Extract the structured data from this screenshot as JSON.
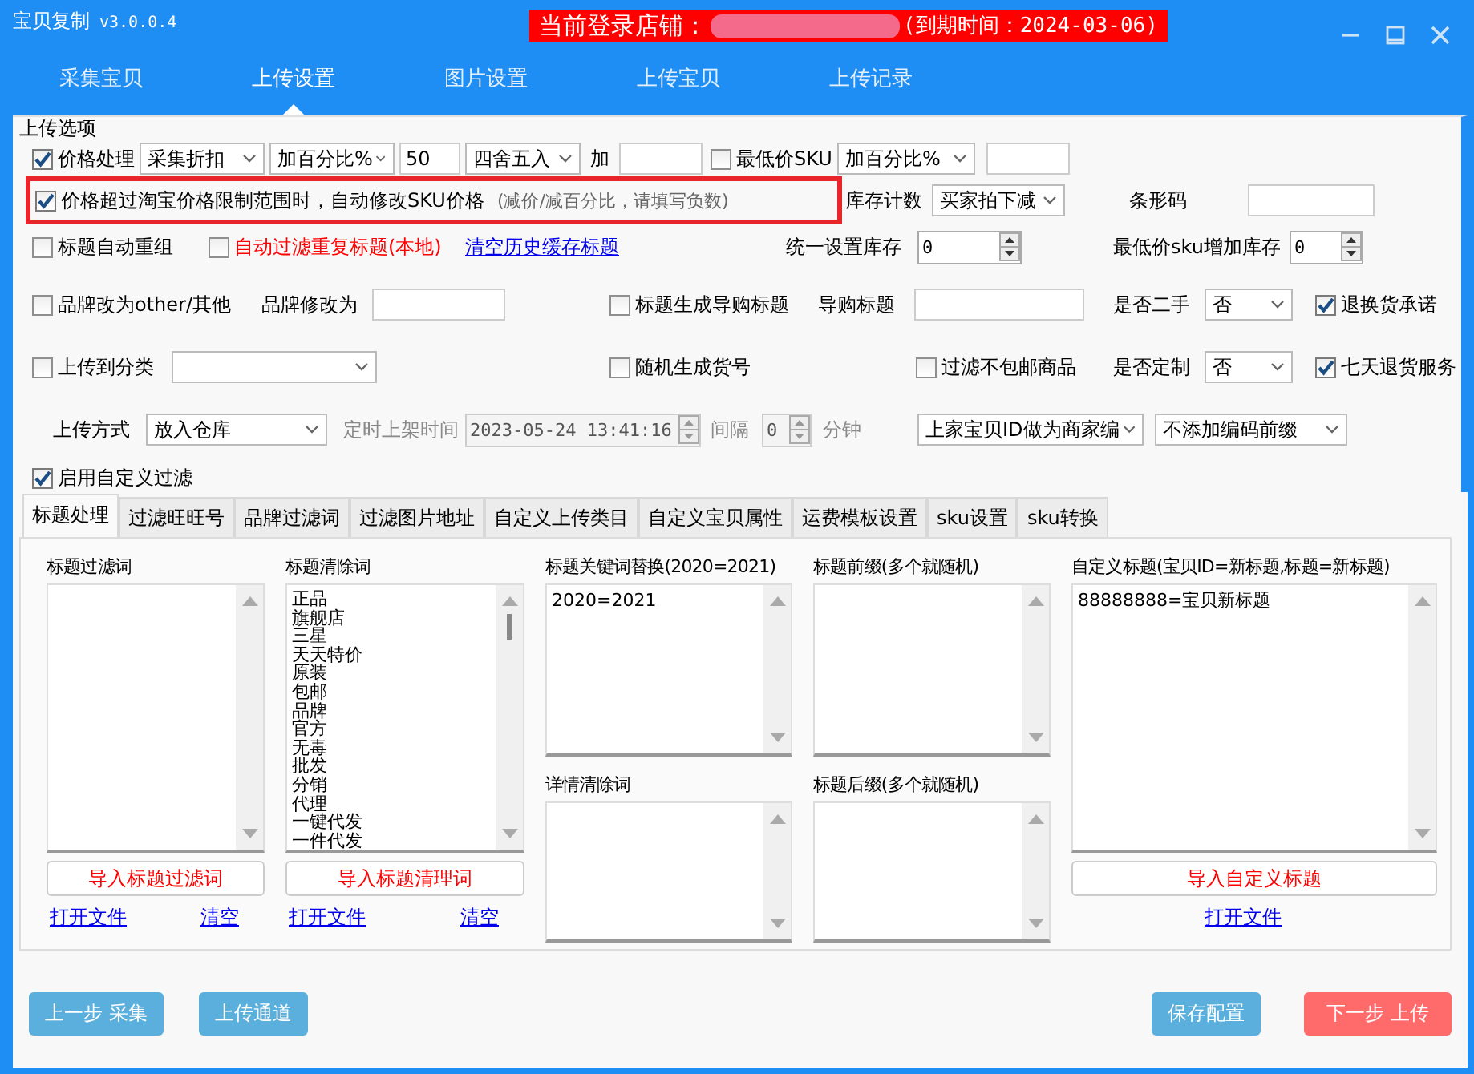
{
  "window": {
    "title": "宝贝复制",
    "version": "v3.0.0.4"
  },
  "login_banner": {
    "label": "当前登录店铺：",
    "expiry": "(到期时间：2024-03-06)"
  },
  "nav_tabs": [
    {
      "label": "采集宝贝",
      "selected": false
    },
    {
      "label": "上传设置",
      "selected": true
    },
    {
      "label": "图片设置",
      "selected": false
    },
    {
      "label": "上传宝贝",
      "selected": false
    },
    {
      "label": "上传记录",
      "selected": false
    }
  ],
  "options": {
    "title": "上传选项",
    "rows": [
      {
        "items": [
          {
            "kind": "checkbox",
            "label": "价格处理",
            "checked": true
          },
          {
            "kind": "select",
            "value": "采集折扣"
          },
          {
            "kind": "select",
            "value": "加百分比%"
          },
          {
            "kind": "input",
            "value": "50"
          },
          {
            "kind": "select",
            "value": "四舍五入"
          },
          {
            "kind": "label",
            "text": "加"
          },
          {
            "kind": "input"
          },
          {
            "kind": "checkbox",
            "label": "最低价SKU",
            "checked": false
          },
          {
            "kind": "select",
            "value": "加百分比%"
          },
          {
            "kind": "input"
          }
        ]
      },
      {
        "items": [
          {
            "kind": "group",
            "highlighted": true,
            "items": [
              {
                "kind": "checkbox",
                "label": "价格超过淘宝价格限制范围时，自动修改SKU价格",
                "checked": true
              },
              {
                "kind": "hint",
                "text": "(减价/减百分比，请填写负数)"
              }
            ]
          },
          {
            "kind": "label",
            "text": "库存计数"
          },
          {
            "kind": "select",
            "value": "买家拍下减"
          },
          {
            "kind": "label",
            "text": "条形码"
          },
          {
            "kind": "input"
          }
        ]
      },
      {
        "items": [
          {
            "kind": "checkbox",
            "label": "标题自动重组",
            "checked": false
          },
          {
            "kind": "checkbox",
            "label": "自动过滤重复标题(本地)",
            "checked": false,
            "color": "#ff0000"
          },
          {
            "kind": "link",
            "text": "清空历史缓存标题"
          },
          {
            "kind": "label",
            "text": "统一设置库存"
          },
          {
            "kind": "spin",
            "value": "0"
          },
          {
            "kind": "label",
            "text": "最低价sku增加库存"
          },
          {
            "kind": "spin",
            "value": "0"
          }
        ]
      },
      {
        "items": [
          {
            "kind": "checkbox",
            "label": "品牌改为other/其他",
            "checked": false
          },
          {
            "kind": "label",
            "text": "品牌修改为"
          },
          {
            "kind": "input"
          },
          {
            "kind": "checkbox",
            "label": "标题生成导购标题",
            "checked": false
          },
          {
            "kind": "label",
            "text": "导购标题"
          },
          {
            "kind": "input"
          },
          {
            "kind": "label",
            "text": "是否二手"
          },
          {
            "kind": "select",
            "value": "否"
          },
          {
            "kind": "checkbox",
            "label": "退换货承诺",
            "checked": true
          }
        ]
      },
      {
        "items": [
          {
            "kind": "checkbox",
            "label": "上传到分类",
            "checked": false
          },
          {
            "kind": "select"
          },
          {
            "kind": "checkbox",
            "label": "随机生成货号",
            "checked": false
          },
          {
            "kind": "checkbox",
            "label": "过滤不包邮商品",
            "checked": false
          },
          {
            "kind": "label",
            "text": "是否定制"
          },
          {
            "kind": "select",
            "value": "否"
          },
          {
            "kind": "checkbox",
            "label": "七天退货服务",
            "checked": true
          }
        ]
      },
      {
        "items": [
          {
            "kind": "label",
            "text": "上传方式",
            "disabled": false
          },
          {
            "kind": "select",
            "value": "放入仓库",
            "disabled": false
          },
          {
            "kind": "label",
            "text": "定时上架时间",
            "disabled": true
          },
          {
            "kind": "spin",
            "value": "2023-05-24 13:41:16",
            "disabled": true
          },
          {
            "kind": "label",
            "text": "间隔",
            "disabled": true
          },
          {
            "kind": "spin",
            "value": "0",
            "disabled": true
          },
          {
            "kind": "label",
            "text": "分钟",
            "disabled": true
          },
          {
            "kind": "select",
            "value": "上家宝贝ID做为商家编",
            "disabled": false
          },
          {
            "kind": "select",
            "value": "不添加编码前缀",
            "disabled": false
          }
        ]
      },
      {
        "items": [
          {
            "kind": "checkbox",
            "label": "启用自定义过滤",
            "checked": true
          }
        ]
      }
    ]
  },
  "filter_tabs": [
    {
      "label": "标题处理",
      "selected": true
    },
    {
      "label": "过滤旺旺号",
      "selected": false
    },
    {
      "label": "品牌过滤词",
      "selected": false
    },
    {
      "label": "过滤图片地址",
      "selected": false
    },
    {
      "label": "自定义上传类目",
      "selected": false
    },
    {
      "label": "自定义宝贝属性",
      "selected": false
    },
    {
      "label": "运费模板设置",
      "selected": false
    },
    {
      "label": "sku设置",
      "selected": false
    },
    {
      "label": "sku转换",
      "selected": false
    }
  ],
  "title_panel": {
    "columns": [
      {
        "fields": [
          {
            "label": "标题过滤词"
          }
        ],
        "button": "导入标题过滤词",
        "links": [
          "打开文件",
          "清空"
        ]
      },
      {
        "fields": [
          {
            "label": "标题清除词",
            "lines": [
              "正品",
              "旗舰店",
              "三星",
              "天天特价",
              "原装",
              "包邮",
              "品牌",
              "官方",
              "无毒",
              "批发",
              "分销",
              "代理",
              "一键代发",
              "一件代发"
            ]
          }
        ],
        "button": "导入标题清理词",
        "links": [
          "打开文件",
          "清空"
        ]
      },
      {
        "fields": [
          {
            "label": "标题关键词替换(2020=2021)",
            "lines": [
              "2020=2021"
            ]
          },
          {
            "label": "详情清除词"
          }
        ]
      },
      {
        "fields": [
          {
            "label": "标题前缀(多个就随机)"
          },
          {
            "label": "标题后缀(多个就随机)"
          }
        ]
      },
      {
        "fields": [
          {
            "label": "自定义标题(宝贝ID=新标题,标题=新标题)",
            "lines": [
              "88888888=宝贝新标题"
            ]
          }
        ],
        "button": "导入自定义标题",
        "links": [
          "打开文件"
        ]
      }
    ]
  },
  "footer": {
    "left": [
      {
        "label": "上一步 采集",
        "kind": "default"
      },
      {
        "label": "上传通道",
        "kind": "default"
      }
    ],
    "right": [
      {
        "label": "保存配置",
        "kind": "default"
      },
      {
        "label": "下一步 上传",
        "kind": "danger"
      }
    ]
  }
}
